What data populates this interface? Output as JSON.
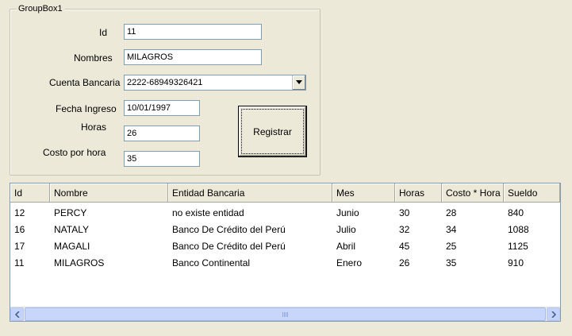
{
  "groupbox": {
    "title": "GroupBox1"
  },
  "form": {
    "id_label": "Id",
    "id_value": "11",
    "nombres_label": "Nombres",
    "nombres_value": "MILAGROS",
    "cuenta_label": "Cuenta Bancaria",
    "cuenta_value": "2222-68949326421",
    "fecha_label": "Fecha Ingreso",
    "fecha_value": "10/01/1997",
    "horas_label": "Horas",
    "horas_value": "26",
    "costo_label": "Costo por hora",
    "costo_value": "35",
    "registrar_label": "Registrar"
  },
  "grid": {
    "columns": [
      "Id",
      "Nombre",
      "Entidad Bancaria",
      "Mes",
      "Horas",
      "Costo * Hora",
      "Sueldo"
    ],
    "rows": [
      [
        "12",
        "PERCY",
        "no existe entidad",
        "Junio",
        "30",
        "28",
        "840"
      ],
      [
        "16",
        "NATALY",
        "Banco De Crédito del Perú",
        "Julio",
        "32",
        "34",
        "1088"
      ],
      [
        "17",
        "MAGALI",
        "Banco De Crédito del Perú",
        "Abril",
        "45",
        "25",
        "1125"
      ],
      [
        "11",
        "MILAGROS",
        "Banco Continental",
        "Enero",
        "26",
        "35",
        "910"
      ]
    ]
  },
  "icons": {
    "dropdown": "chevron-down-icon",
    "scroll_left": "arrow-left-icon",
    "scroll_right": "arrow-right-icon"
  }
}
